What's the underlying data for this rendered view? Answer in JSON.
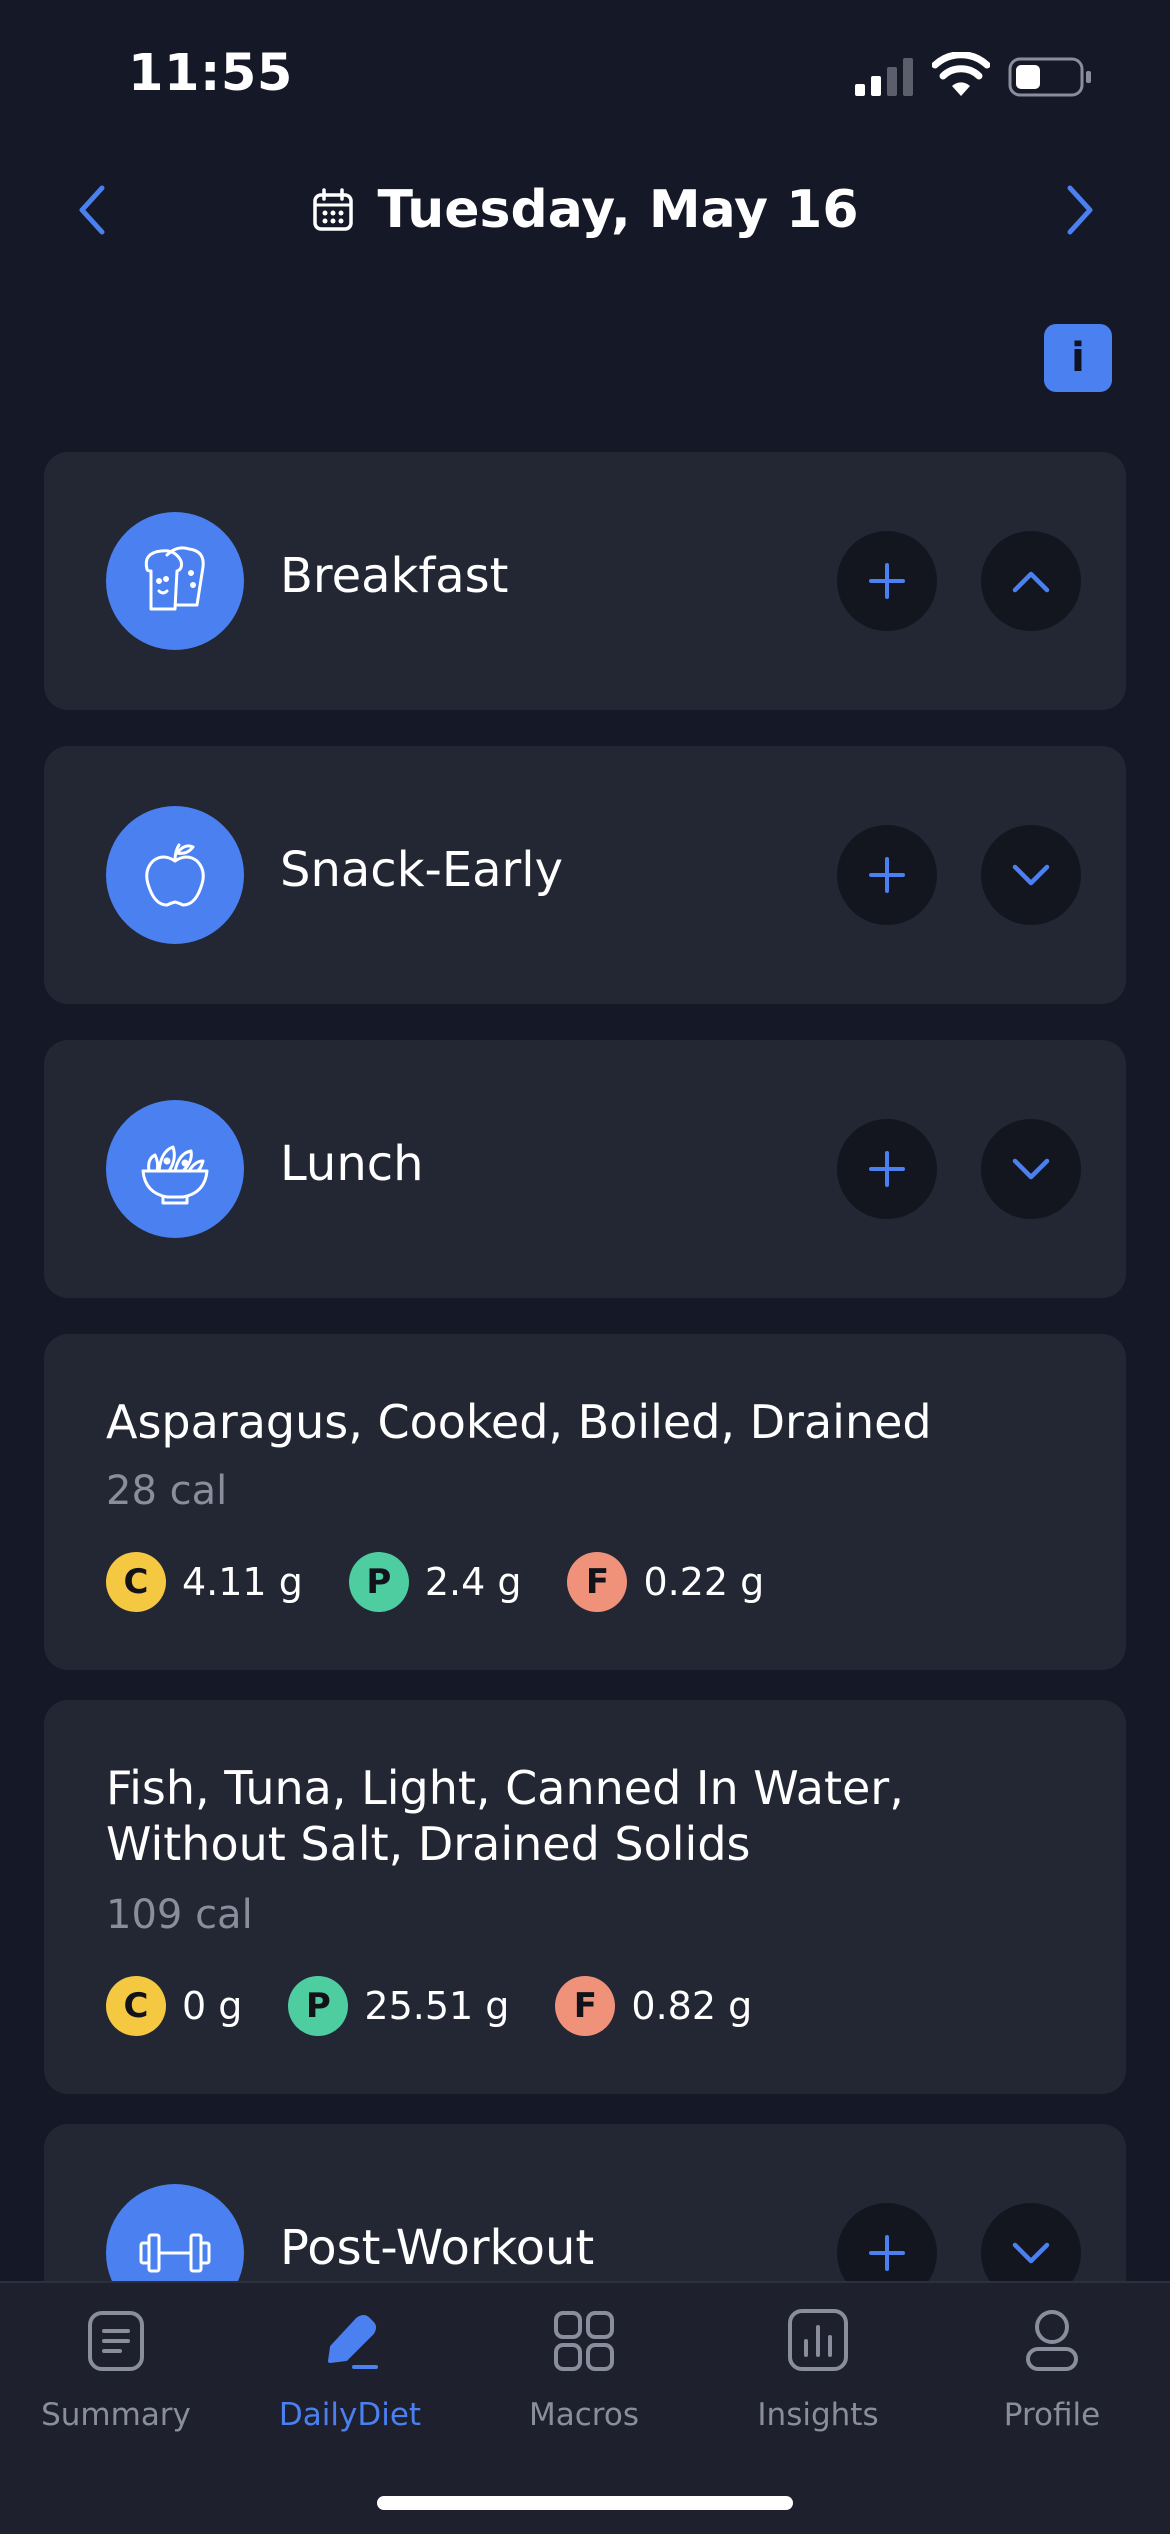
{
  "status": {
    "time": "11:55"
  },
  "header": {
    "date": "Tuesday, May 16"
  },
  "info_label": "i",
  "meals": [
    {
      "name": "Breakfast",
      "icon": "toast-icon",
      "expanded": true
    },
    {
      "name": "Snack-Early",
      "icon": "apple-icon",
      "expanded": false
    },
    {
      "name": "Lunch",
      "icon": "salad-bowl-icon",
      "expanded": false
    },
    {
      "name": "Post-Workout",
      "icon": "dumbbell-icon",
      "expanded": false
    }
  ],
  "foods": [
    {
      "name": "Asparagus, Cooked, Boiled, Drained",
      "calories": "28 cal",
      "macros": {
        "c": "4.11 g",
        "p": "2.4 g",
        "f": "0.22 g"
      }
    },
    {
      "name": "Fish, Tuna, Light, Canned In Water, Without Salt, Drained Solids",
      "calories": "109 cal",
      "macros": {
        "c": "0 g",
        "p": "25.51 g",
        "f": "0.82 g"
      }
    }
  ],
  "macro_letters": {
    "c": "C",
    "p": "P",
    "f": "F"
  },
  "tabs": [
    {
      "label": "Summary",
      "icon": "document-icon",
      "active": false
    },
    {
      "label": "DailyDiet",
      "icon": "pencil-icon",
      "active": true
    },
    {
      "label": "Macros",
      "icon": "grid-icon",
      "active": false
    },
    {
      "label": "Insights",
      "icon": "bar-chart-icon",
      "active": false
    },
    {
      "label": "Profile",
      "icon": "person-icon",
      "active": false
    }
  ],
  "colors": {
    "accent": "#4a80f0",
    "background": "#151826",
    "card": "#232633",
    "carbs": "#f5c842",
    "protein": "#4ecda0",
    "fat": "#f0917a"
  }
}
